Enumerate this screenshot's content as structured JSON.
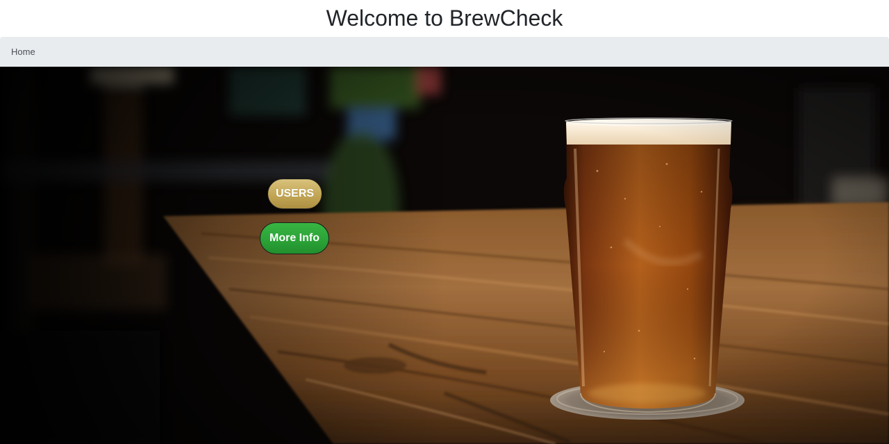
{
  "header": {
    "title": "Welcome to BrewCheck"
  },
  "breadcrumb": {
    "items": [
      {
        "label": "Home"
      }
    ]
  },
  "hero": {
    "background": "photo of a pint of amber beer on a wooden bar counter",
    "buttons": {
      "users_label": "USERS",
      "more_info_label": "More Info"
    }
  },
  "colors": {
    "breadcrumb_bg": "#e9ecef",
    "users_button": "#c9ae5e",
    "more_info_button": "#2ea83a",
    "title_text": "#212529"
  }
}
